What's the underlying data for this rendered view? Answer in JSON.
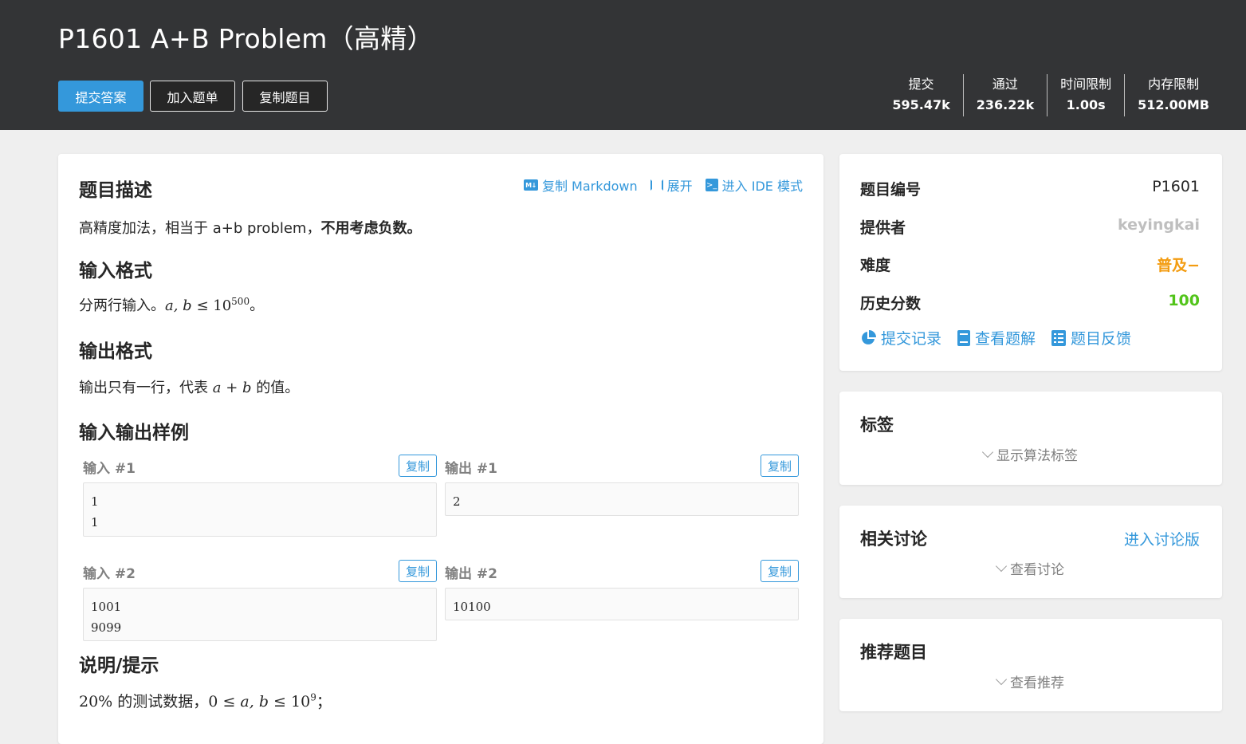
{
  "header": {
    "title": "P1601 A+B Problem（高精）",
    "buttons": {
      "submit": "提交答案",
      "add_list": "加入题单",
      "copy_problem": "复制题目"
    },
    "stats": [
      {
        "key": "提交",
        "value": "595.47k"
      },
      {
        "key": "通过",
        "value": "236.22k"
      },
      {
        "key": "时间限制",
        "value": "1.00s"
      },
      {
        "key": "内存限制",
        "value": "512.00MB"
      }
    ]
  },
  "main": {
    "toolbar": {
      "markdown": "复制 Markdown",
      "expand": "展开",
      "ide": "进入 IDE 模式",
      "md_icon": "M↓"
    },
    "desc_title": "题目描述",
    "desc_text": "高精度加法，相当于 a+b problem，",
    "desc_bold": "不用考虑负数。",
    "input_title": "输入格式",
    "input_text_pre": "分两行输入。",
    "input_math": "a, b",
    "input_le": "≤",
    "input_base": "10",
    "input_exp": "500",
    "input_text_post": "。",
    "output_title": "输出格式",
    "output_text_pre": "输出只有一行，代表",
    "output_math_a": "a",
    "output_plus": "+",
    "output_math_b": "b",
    "output_text_post": "的值。",
    "samples_title": "输入输出样例",
    "samples": [
      {
        "in_label": "输入 #1",
        "out_label": "输出 #1",
        "input": "1\n1",
        "output": "2"
      },
      {
        "in_label": "输入 #2",
        "out_label": "输出 #2",
        "input": "1001\n9099",
        "output": "10100"
      }
    ],
    "copy_label": "复制",
    "hint_title": "说明/提示",
    "hint_pct": "20%",
    "hint_text": "的测试数据，",
    "hint_zero": "0",
    "hint_le": "≤",
    "hint_math": "a, b",
    "hint_base": "10",
    "hint_exp": "9",
    "hint_end": "；"
  },
  "info": {
    "id_key": "题目编号",
    "id_val": "P1601",
    "provider_key": "提供者",
    "provider_val": "keyingkai",
    "difficulty_key": "难度",
    "difficulty_val": "普及−",
    "score_key": "历史分数",
    "score_val": "100",
    "links": {
      "records": "提交记录",
      "solutions": "查看题解",
      "feedback": "题目反馈"
    },
    "colors": {
      "difficulty": "#f39c11",
      "score": "#52c41a",
      "provider": "#bfbfbf",
      "accent": "#3498db"
    }
  },
  "tags": {
    "title": "标签",
    "toggle": "显示算法标签"
  },
  "discuss": {
    "title": "相关讨论",
    "enter": "进入讨论版",
    "toggle": "查看讨论"
  },
  "recommend": {
    "title": "推荐题目",
    "toggle": "查看推荐"
  }
}
